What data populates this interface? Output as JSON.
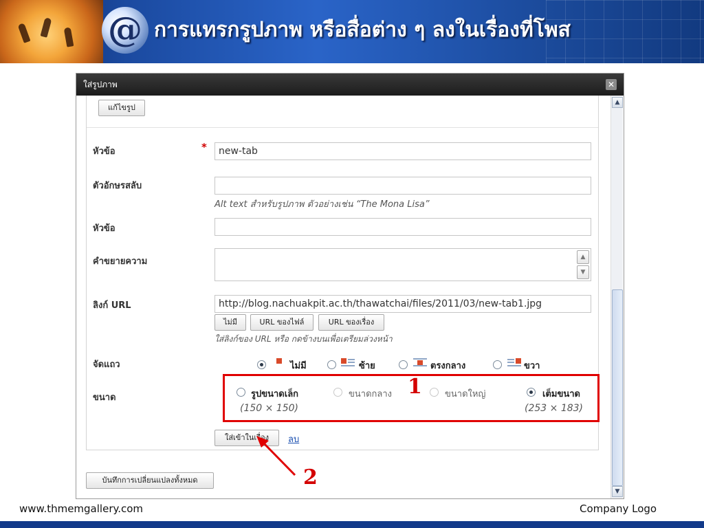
{
  "slide": {
    "title": "การแทรกรูปภาพ หรือสื่อต่าง ๆ ลงในเรื่องที่โพส",
    "footer_left": "www.thmemgallery.com",
    "footer_right": "Company Logo"
  },
  "dialog": {
    "title": "ใส่รูปภาพ",
    "close_glyph": "✕",
    "edit_image_button": "แก้ไขรูป",
    "fields": {
      "title_label": "หัวข้อ",
      "title_value": "new-tab",
      "alt_label": "ตัวอักษรสลับ",
      "alt_value": "",
      "alt_hint": "Alt text สำหรับรูปภาพ ตัวอย่างเช่น “The Mona Lisa”",
      "caption_label": "หัวข้อ",
      "caption_value": "",
      "description_label": "คำขยายความ",
      "description_value": "",
      "link_label": "ลิงก์ URL",
      "link_value": "http://blog.nachuakpit.ac.th/thawatchai/files/2011/03/new-tab1.jpg",
      "link_buttons": [
        "ไม่มี",
        "URL ของไฟล์",
        "URL ของเรื่อง"
      ],
      "link_hint": "ใส่ลิงก์ของ URL หรือ กดข้างบนเพื่อเตรียมล่วงหน้า"
    },
    "alignment": {
      "label": "จัดแถว",
      "options": [
        "ไม่มี",
        "ซ้าย",
        "ตรงกลาง",
        "ขวา"
      ],
      "selected": "ไม่มี"
    },
    "size": {
      "label": "ขนาด",
      "options": [
        "รูปขนาดเล็ก",
        "ขนาดกลาง",
        "ขนาดใหญ่",
        "เต็มขนาด"
      ],
      "selected": "เต็มขนาด",
      "small_dims": "(150 × 150)",
      "full_dims": "(253 × 183)"
    },
    "insert_button": "ใส่เข้าในเรื่อง",
    "delete_link": "ลบ",
    "save_all_button": "บันทึกการเปลี่ยนแปลงทั้งหมด",
    "scroll_up_glyph": "▲",
    "scroll_down_glyph": "▼",
    "textarea_up_glyph": "▲",
    "textarea_down_glyph": "▼"
  },
  "annotations": {
    "marker_1": "1",
    "marker_2": "2",
    "highlight_color": "#e00000"
  }
}
